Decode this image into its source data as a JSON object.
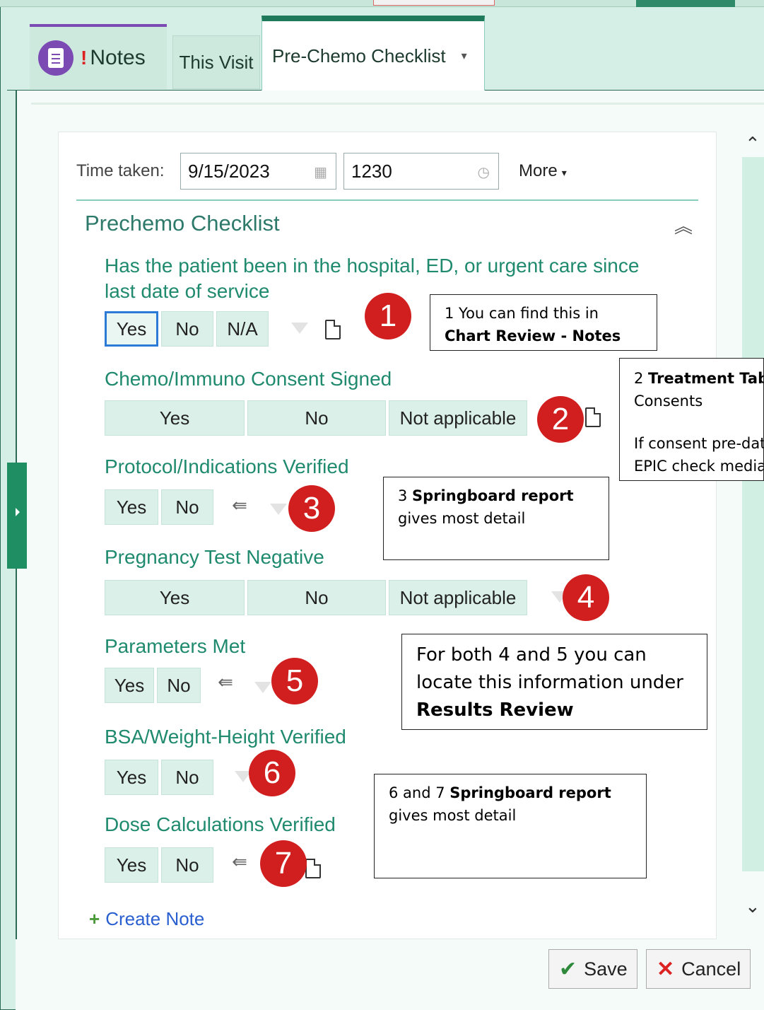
{
  "tabs": {
    "notes_alert": "!",
    "notes_label": "Notes",
    "this_visit": "This Visit",
    "active": "Pre-Chemo Checklist",
    "active_caret": "▾"
  },
  "form": {
    "time_taken_label": "Time taken:",
    "date_value": "9/15/2023",
    "time_value": "1230",
    "more_label": "More",
    "more_caret": "▾",
    "section_title": "Prechemo Checklist",
    "collapse_glyph": "︽"
  },
  "questions": [
    {
      "label_line1": "Has the patient been in the hospital, ED, or urgent care since",
      "label_line2": "last date of service",
      "options": [
        "Yes",
        "No",
        "N/A"
      ],
      "selected": "Yes"
    },
    {
      "label": "Chemo/Immuno Consent Signed",
      "options": [
        "Yes",
        "No",
        "Not applicable"
      ]
    },
    {
      "label": "Protocol/Indications Verified",
      "options": [
        "Yes",
        "No"
      ]
    },
    {
      "label": "Pregnancy Test Negative",
      "options": [
        "Yes",
        "No",
        "Not applicable"
      ]
    },
    {
      "label": "Parameters Met",
      "options": [
        "Yes",
        "No"
      ]
    },
    {
      "label": "BSA/Weight-Height Verified",
      "options": [
        "Yes",
        "No"
      ]
    },
    {
      "label": "Dose Calculations Verified",
      "options": [
        "Yes",
        "No"
      ]
    }
  ],
  "badges": [
    "1",
    "2",
    "3",
    "4",
    "5",
    "6",
    "7"
  ],
  "notes": {
    "n1_line1": "1 You can find this in",
    "n1_line2": "Chart Review - Notes",
    "n2_prefix": "2 ",
    "n2_bold": "Treatment Tab-",
    "n2_line2": "Consents",
    "n2_line3": "If consent pre-dat",
    "n2_line4": "EPIC check media",
    "n3_prefix": "3 ",
    "n3_bold": "Springboard report",
    "n3_line2": "gives most detail",
    "n45_line1": "For both 4 and 5 you can",
    "n45_line2": "locate this information under",
    "n45_line3": "Results Review",
    "n67_prefix": "6 and 7 ",
    "n67_bold": "Springboard report",
    "n67_line2": "gives most detail"
  },
  "footer": {
    "create_note": "Create Note",
    "save": "Save",
    "cancel": "Cancel"
  },
  "colors": {
    "accent_green": "#1f7a5c",
    "question_text": "#1f8a6e",
    "badge_red": "#d11f1f",
    "notes_purple": "#7b4bb3",
    "selected_border": "#2b7bd6"
  }
}
